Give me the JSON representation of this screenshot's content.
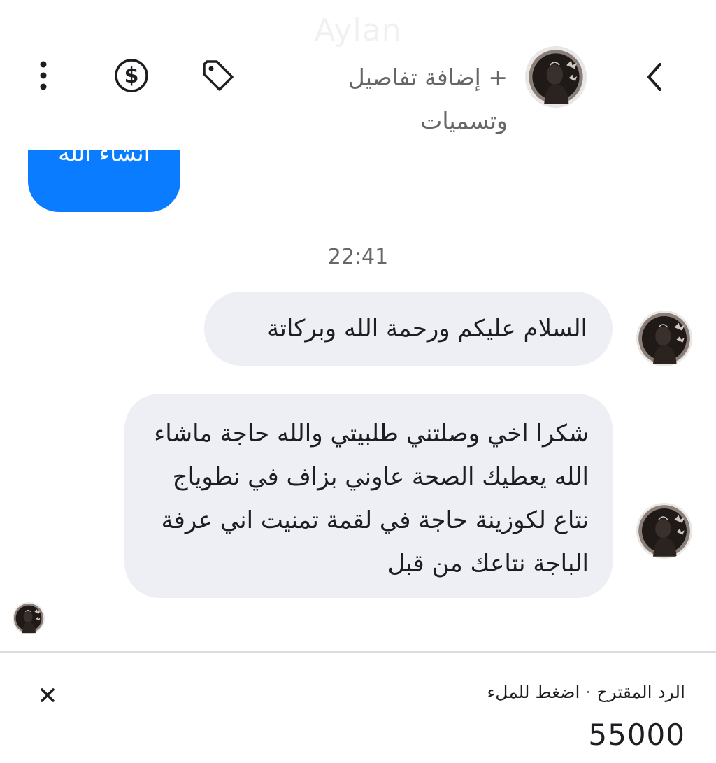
{
  "header": {
    "contact_name": "Aylan",
    "add_details_label": "+ إضافة تفاصيل وتسميات",
    "icons": {
      "back": "chevron-left-icon",
      "avatar": "avatar",
      "tag": "tag-icon",
      "dollar": "dollar-icon",
      "more": "more-vertical-icon"
    }
  },
  "chat": {
    "sent_partial_text": "انشاء الله",
    "timestamp": "22:41",
    "messages": [
      {
        "text": "السلام عليكم ورحمة الله وبركاتة"
      },
      {
        "text": "شكرا اخي وصلتني طلبيتي والله حاجة ماشاء الله يعطيك الصحة عاوني بزاف في نطوياج نتاع لكوزينة حاجة في لقمة تمنيت اني عرفة الباجة نتاعك من قبل"
      }
    ]
  },
  "suggested_reply": {
    "label": "الرد المقترح",
    "separator": "·",
    "hint": "اضغط للملء",
    "value": "55000"
  },
  "colors": {
    "sent_bubble": "#0a7cff",
    "received_bubble": "#eeeff4",
    "secondary_text": "#65676b"
  }
}
